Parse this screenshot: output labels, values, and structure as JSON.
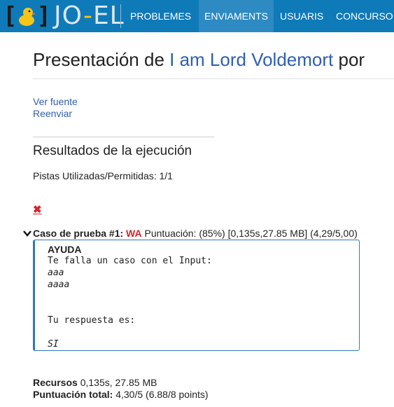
{
  "navbar": {
    "logo_text_left": "JO",
    "logo_text_dash": "-",
    "logo_text_right": "EL",
    "items": [
      {
        "label": "PROBLEMES"
      },
      {
        "label": "ENVIAMENTS"
      },
      {
        "label": "USUARIS"
      },
      {
        "label": "CONCURSO"
      }
    ],
    "active_index": 1,
    "colors": {
      "bar": "#0f7ab8",
      "active": "#2d8ac2"
    }
  },
  "page": {
    "title_prefix": "Presentación de ",
    "problem_name": "I am Lord Voldemort",
    "title_suffix": " por"
  },
  "actions": {
    "view_source": "Ver fuente",
    "resend": "Reenviar"
  },
  "results": {
    "heading": "Resultados de la ejecución",
    "hints": "Pistas Utilizadas/Permitidas: 1/1",
    "status_icon": "x-icon",
    "case": {
      "label": "Caso de prueba #1:",
      "verdict": "WA",
      "details": "Puntuación: (85%) [0,135s,27.85 MB] (4,29/5,00)",
      "help_title": "AYUDA",
      "line1": "Te falla un caso con el Input:",
      "input_line1": "aaa",
      "input_line2": "aaaa",
      "answer_label": "Tu respuesta es:",
      "answer": "SI"
    }
  },
  "footer": {
    "resources_label": "Recursos",
    "resources_value": " 0,135s, 27.85 MB",
    "score_label": "Puntuación total:",
    "score_value": " 4,30/5 (6.88/8 points)"
  }
}
